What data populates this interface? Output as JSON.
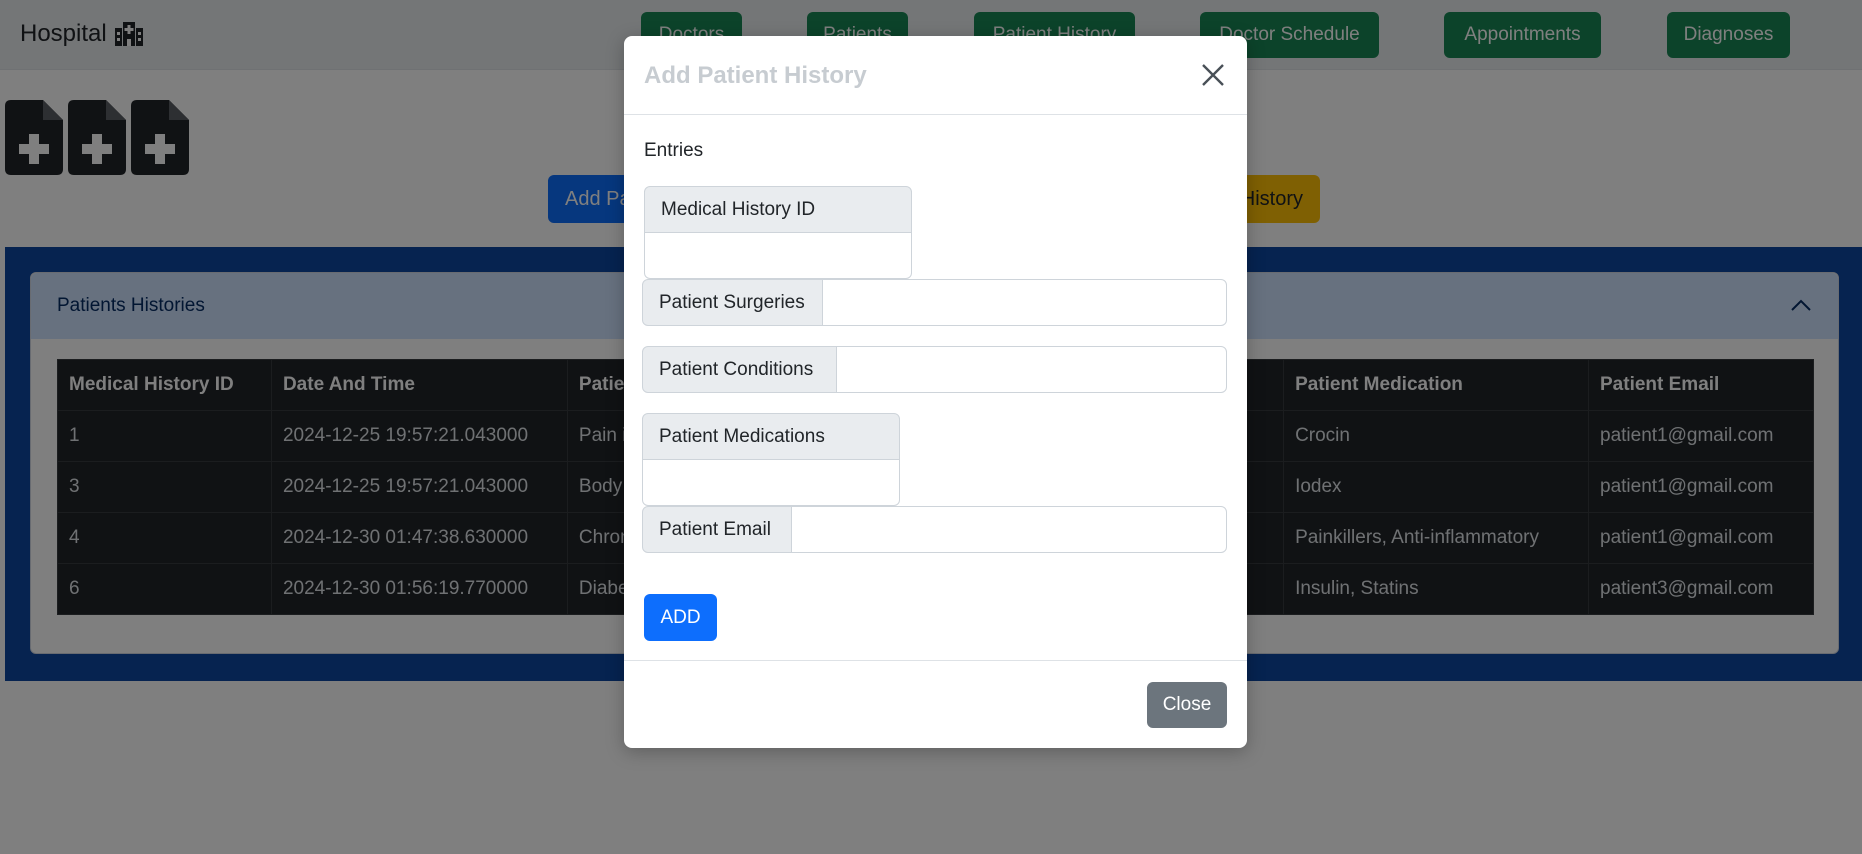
{
  "navbar": {
    "brand": "Hospital",
    "brand_icon": "hospital-icon",
    "links": [
      "Doctors",
      "Patients",
      "Patient History",
      "Doctor Schedule",
      "Appointments",
      "Diagnoses"
    ],
    "link_color": "#198754"
  },
  "actions": {
    "add_label": "Add Pa",
    "history_label": "History",
    "add_color": "#0d6efd",
    "history_color": "#ffc107"
  },
  "accordion": {
    "title": "Patients Histories",
    "icon": "chevron-up-icon"
  },
  "table": {
    "headers": [
      "Medical History ID",
      "Date And Time",
      "Patie",
      "Patient Medication",
      "Patient Email"
    ],
    "rows": [
      [
        "1",
        "2024-12-25 19:57:21.043000",
        "Pain i",
        "Crocin",
        "patient1@gmail.com"
      ],
      [
        "3",
        "2024-12-25 19:57:21.043000",
        "Body",
        "Iodex",
        "patient1@gmail.com"
      ],
      [
        "4",
        "2024-12-30 01:47:38.630000",
        "Chron",
        "Painkillers, Anti-inflammatory",
        "patient1@gmail.com"
      ],
      [
        "6",
        "2024-12-30 01:56:19.770000",
        "Diabe",
        "Insulin, Statins",
        "patient3@gmail.com"
      ]
    ]
  },
  "modal": {
    "title": "Add Patient History",
    "close_icon": "close-icon",
    "entries_label": "Entries",
    "fields": {
      "medical_history_id": {
        "label": "Medical History ID",
        "value": ""
      },
      "patient_surgeries": {
        "label": "Patient Surgeries",
        "value": ""
      },
      "patient_conditions": {
        "label": "Patient Conditions",
        "value": ""
      },
      "patient_medications": {
        "label": "Patient Medications",
        "value": ""
      },
      "patient_email": {
        "label": "Patient Email",
        "value": ""
      }
    },
    "add_button": "ADD",
    "close_button": "Close"
  }
}
